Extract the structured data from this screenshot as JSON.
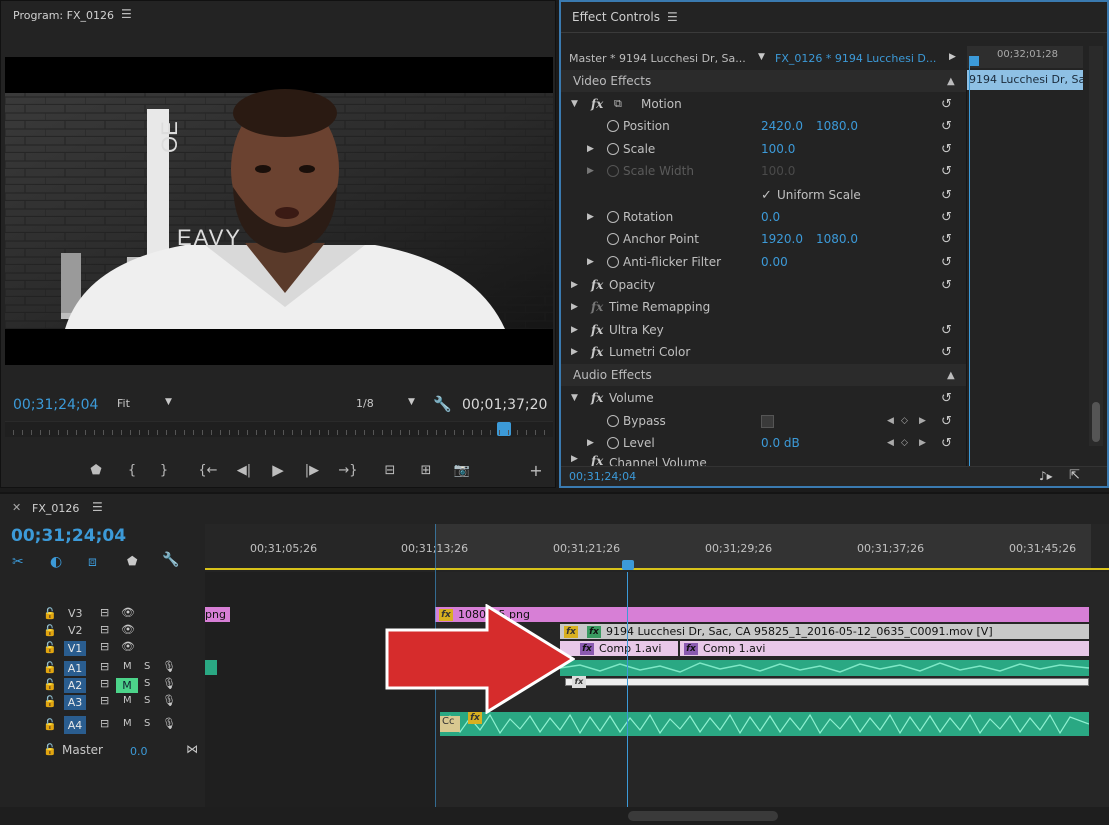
{
  "program": {
    "title": "Program: FX_0126",
    "timecode_current": "00;31;24;04",
    "zoom": "Fit",
    "resolution": "1/8",
    "timecode_duration": "00;01;37;20",
    "logo_text_top": "OE",
    "logo_text_side": "EAVY"
  },
  "effect_controls": {
    "title": "Effect Controls",
    "master_label": "Master * 9194 Lucchesi Dr, Sa...",
    "clip_label": "FX_0126 * 9194 Lucchesi D...",
    "mini_timecode": "00;32;01;28",
    "mini_clip": "9194 Lucchesi Dr, Sa",
    "video_effects": "Video Effects",
    "motion": "Motion",
    "position": "Position",
    "position_x": "2420.0",
    "position_y": "1080.0",
    "scale": "Scale",
    "scale_value": "100.0",
    "scale_width": "Scale Width",
    "scale_width_value": "100.0",
    "uniform_scale": "Uniform Scale",
    "rotation": "Rotation",
    "rotation_value": "0.0",
    "anchor_point": "Anchor Point",
    "anchor_x": "1920.0",
    "anchor_y": "1080.0",
    "anti_flicker": "Anti-flicker Filter",
    "anti_flicker_value": "0.00",
    "opacity": "Opacity",
    "time_remapping": "Time Remapping",
    "ultra_key": "Ultra Key",
    "lumetri": "Lumetri Color",
    "audio_effects": "Audio Effects",
    "volume": "Volume",
    "bypass": "Bypass",
    "level": "Level",
    "level_value": "0.0 dB",
    "channel_volume": "Channel Volume",
    "footer_timecode": "00;31;24;04"
  },
  "timeline": {
    "sequence": "FX_0126",
    "timecode": "00;31;24;04",
    "ruler": [
      "00;31;05;26",
      "00;31;13;26",
      "00;31;21;26",
      "00;31;29;26",
      "00;31;37;26",
      "00;31;45;26"
    ],
    "tracks": {
      "v3": "V3",
      "v2": "V2",
      "v1": "V1",
      "a1": "A1",
      "a2": "A2",
      "a3": "A3",
      "a4": "A4",
      "m": "M",
      "s": "S"
    },
    "master": "Master",
    "master_value": "0.0",
    "clips": {
      "png_left": "png",
      "png_main": "1080_25.png",
      "mov": "9194 Lucchesi Dr, Sac, CA 95825_1_2016-05-12_0635_C0091.mov [V]",
      "comp1": "Comp 1.avi",
      "comp2": "Comp 1.avi",
      "cc": "Cc"
    }
  },
  "colors": {
    "accent": "#3c9ad8",
    "pink_clip": "#d77fd6",
    "audio_green": "#2aa883",
    "arrow_red": "#d62c2c"
  }
}
